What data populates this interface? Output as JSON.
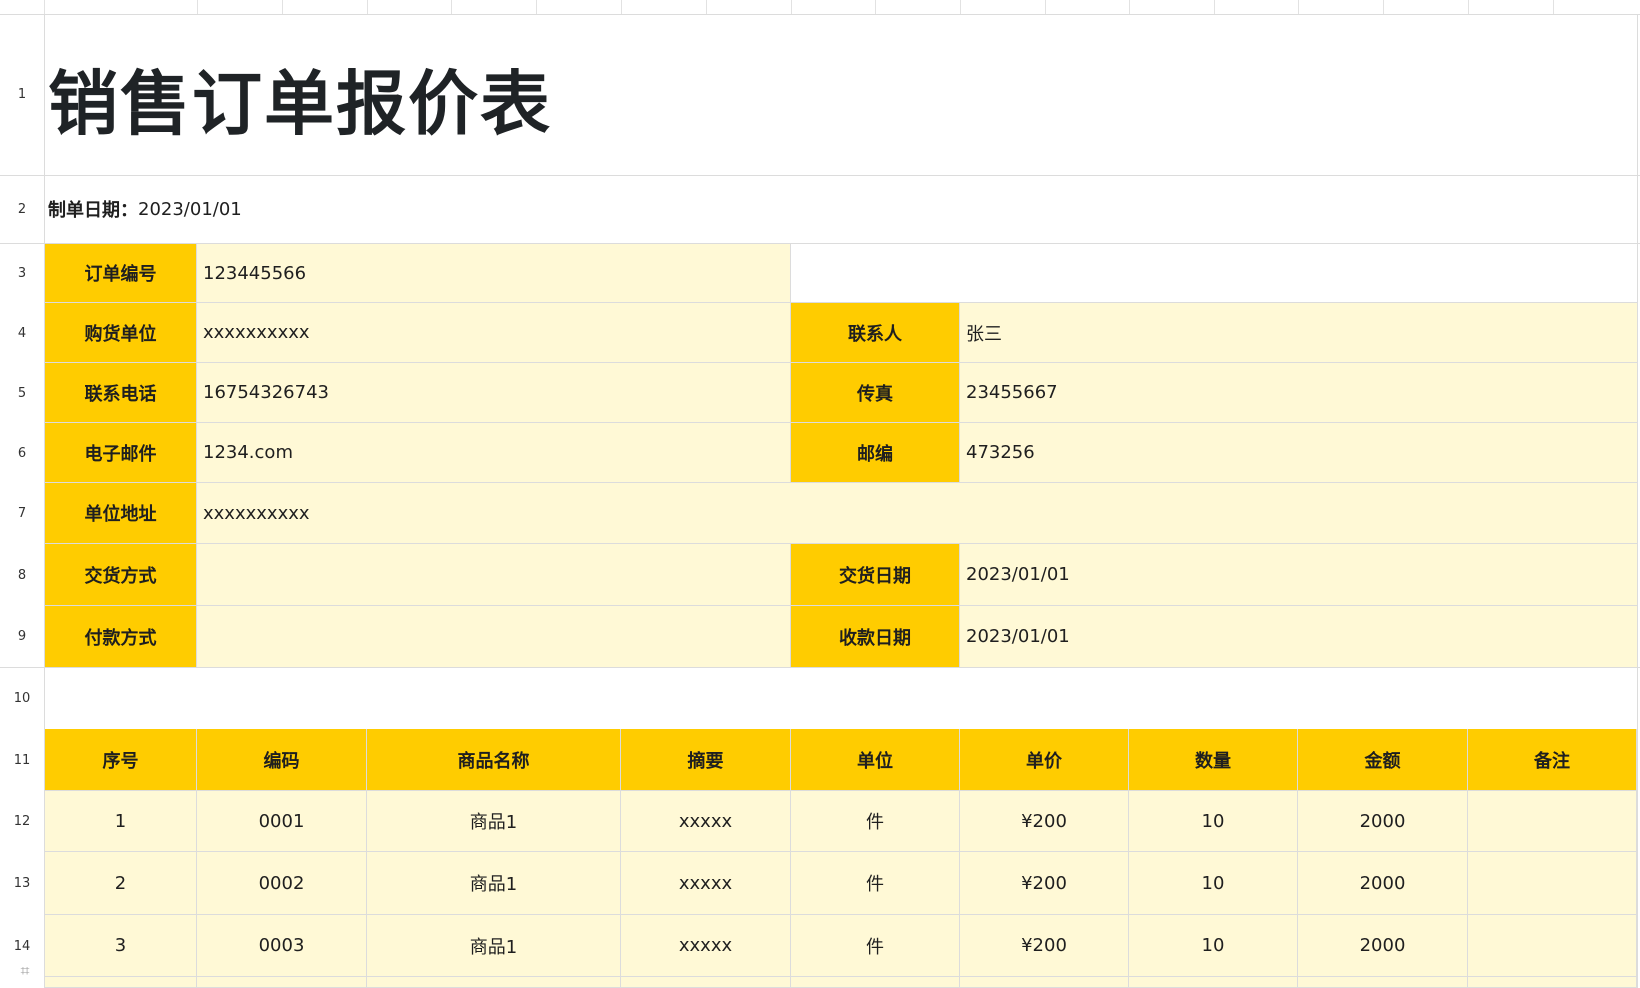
{
  "sheet": {
    "title": "销售订单报价表",
    "date_label": "制单日期：",
    "date_value": "2023/01/01",
    "row_numbers": [
      "1",
      "2",
      "3",
      "4",
      "5",
      "6",
      "7",
      "8",
      "9",
      "10",
      "11",
      "12",
      "13",
      "14"
    ],
    "info": {
      "order_no_label": "订单编号",
      "order_no": "123445566",
      "buyer_label": "购货单位",
      "buyer": "xxxxxxxxxx",
      "contact_label": "联系人",
      "contact": "张三",
      "phone_label": "联系电话",
      "phone": "16754326743",
      "fax_label": "传真",
      "fax": "23455667",
      "email_label": "电子邮件",
      "email": "1234.com",
      "zip_label": "邮编",
      "zip": "473256",
      "address_label": "单位地址",
      "address": "xxxxxxxxxx",
      "delivery_method_label": "交货方式",
      "delivery_method": "",
      "delivery_date_label": "交货日期",
      "delivery_date": "2023/01/01",
      "payment_method_label": "付款方式",
      "payment_method": "",
      "receipt_date_label": "收款日期",
      "receipt_date": "2023/01/01"
    },
    "table": {
      "headers": [
        "序号",
        "编码",
        "商品名称",
        "摘要",
        "单位",
        "单价",
        "数量",
        "金额",
        "备注"
      ],
      "rows": [
        [
          "1",
          "0001",
          "商品1",
          "xxxxx",
          "件",
          "¥200",
          "10",
          "2000",
          ""
        ],
        [
          "2",
          "0002",
          "商品1",
          "xxxxx",
          "件",
          "¥200",
          "10",
          "2000",
          ""
        ],
        [
          "3",
          "0003",
          "商品1",
          "xxxxx",
          "件",
          "¥200",
          "10",
          "2000",
          ""
        ]
      ]
    }
  },
  "colors": {
    "header_fill": "#ffcc00",
    "cell_fill": "#fff9d6",
    "grid": "#dcdcdc"
  },
  "icons": {
    "freeze": "freeze-panes-icon"
  }
}
